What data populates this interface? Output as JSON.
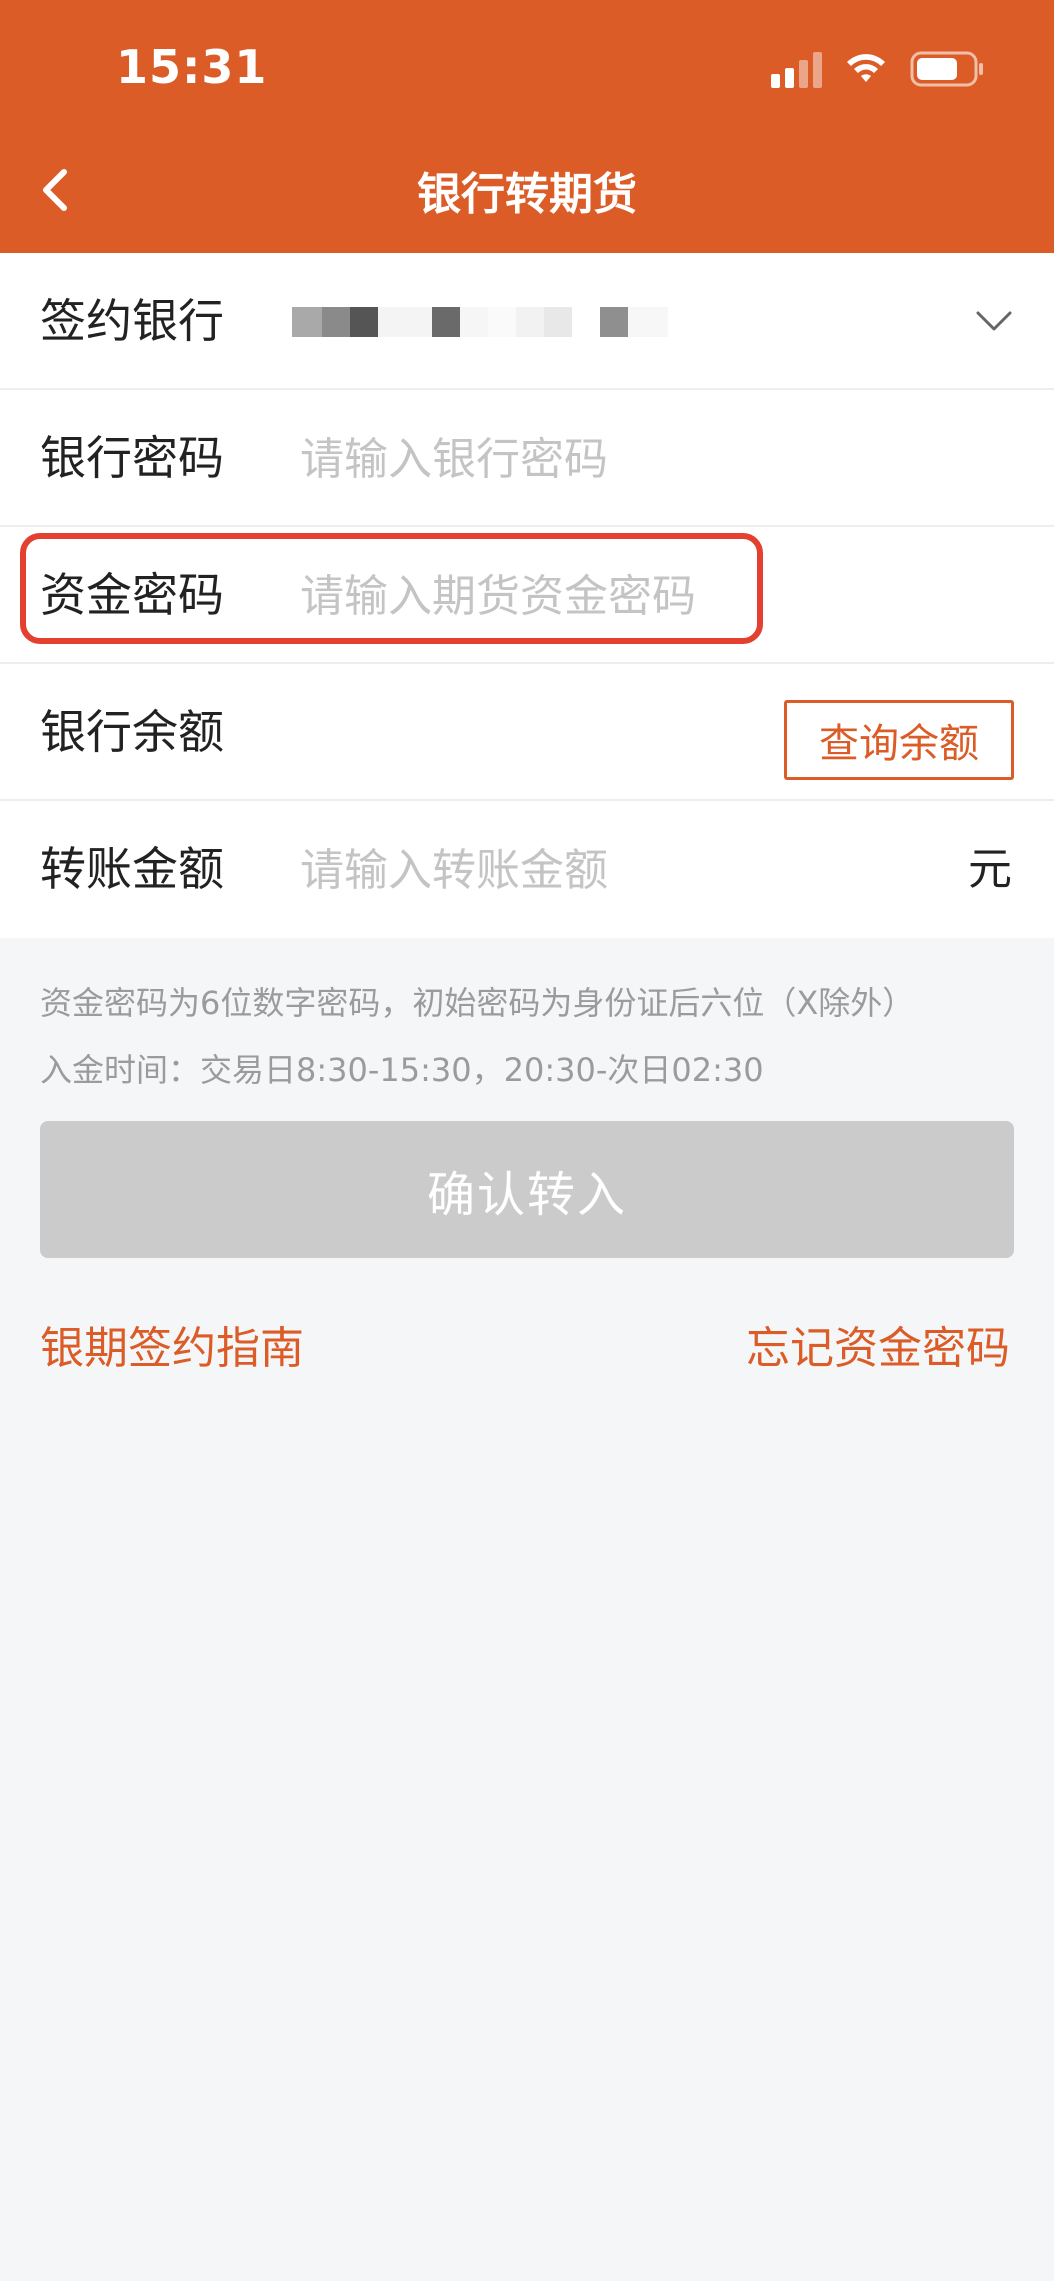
{
  "status_bar": {
    "time": "15:31"
  },
  "nav": {
    "title": "银行转期货"
  },
  "form": {
    "bank": {
      "label": "签约银行"
    },
    "bank_password": {
      "label": "银行密码",
      "placeholder": "请输入银行密码"
    },
    "fund_password": {
      "label": "资金密码",
      "placeholder": "请输入期货资金密码"
    },
    "bank_balance": {
      "label": "银行余额",
      "button": "查询余额"
    },
    "transfer_amount": {
      "label": "转账金额",
      "placeholder": "请输入转账金额",
      "unit": "元"
    }
  },
  "hints": {
    "password_hint": "资金密码为6位数字密码，初始密码为身份证后六位（X除外）",
    "deposit_time": "入金时间：交易日8:30-15:30，20:30-次日02:30"
  },
  "confirm_button": "确认转入",
  "links": {
    "guide": "银期签约指南",
    "forgot": "忘记资金密码"
  },
  "colors": {
    "brand": "#db5c27",
    "highlight": "#e4402f",
    "disabled_button": "#cbcbcb",
    "background": "#f5f6f8"
  }
}
